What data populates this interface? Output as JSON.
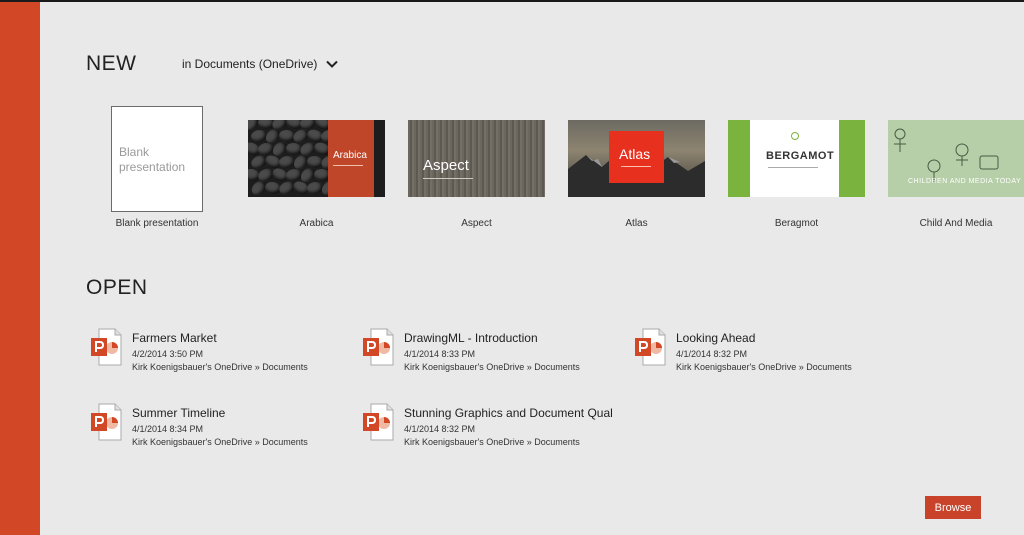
{
  "accent": "#d24726",
  "new_section": {
    "title": "NEW",
    "location": "in Documents (OneDrive)",
    "templates": [
      {
        "name": "Blank presentation",
        "thumb_text": "Blank presentation"
      },
      {
        "name": "Arabica",
        "thumb_text": "Arabica"
      },
      {
        "name": "Aspect",
        "thumb_text": "Aspect"
      },
      {
        "name": "Atlas",
        "thumb_text": "Atlas"
      },
      {
        "name": "Beragmot",
        "thumb_text": "BERGAMOT"
      },
      {
        "name": "Child And Media",
        "thumb_text": "CHILDREN AND MEDIA TODAY"
      }
    ]
  },
  "open_section": {
    "title": "OPEN",
    "files": [
      {
        "name": "Farmers Market",
        "date": "4/2/2014 3:50 PM",
        "path": "Kirk Koenigsbauer's OneDrive » Documents"
      },
      {
        "name": "DrawingML - Introduction",
        "date": "4/1/2014 8:33 PM",
        "path": "Kirk Koenigsbauer's OneDrive » Documents"
      },
      {
        "name": "Looking Ahead",
        "date": "4/1/2014 8:32 PM",
        "path": "Kirk Koenigsbauer's OneDrive » Documents"
      },
      {
        "name": "Summer Timeline",
        "date": "4/1/2014 8:34 PM",
        "path": "Kirk Koenigsbauer's OneDrive » Documents"
      },
      {
        "name": "Stunning Graphics and Document Qual",
        "date": "4/1/2014 8:32 PM",
        "path": "Kirk Koenigsbauer's OneDrive » Documents"
      }
    ]
  },
  "browse_label": "Browse"
}
